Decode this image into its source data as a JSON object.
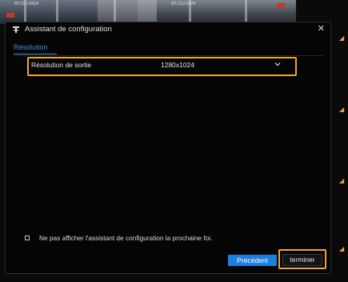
{
  "background": {
    "camera_timestamps": [
      "07/22/2024",
      "07/22/2024"
    ]
  },
  "dialog": {
    "title": "Assistant de configuration",
    "close_glyph": "✕",
    "tab_label": "Résolution",
    "field": {
      "label": "Résolution de sortie",
      "value": "1280x1024"
    },
    "checkbox_label": "Ne pas afficher l'assistant de configuration la prochaine foi.",
    "buttons": {
      "previous": "Précédent",
      "finish": "terminer"
    }
  },
  "colors": {
    "accent_blue": "#1e7fe0",
    "highlight_orange": "#f2a628",
    "background": "#050505"
  }
}
